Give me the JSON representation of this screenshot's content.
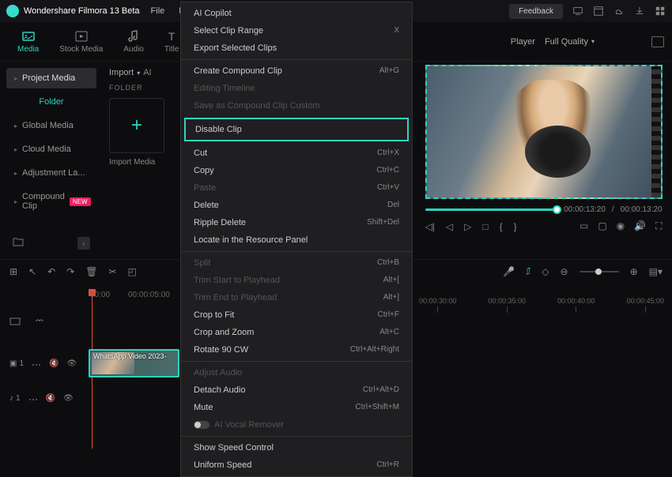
{
  "app": {
    "title": "Wondershare Filmora 13 Beta"
  },
  "menubar": {
    "file": "File",
    "edit": "Edit"
  },
  "feedback": "Feedback",
  "tabs": {
    "media": "Media",
    "stock": "Stock Media",
    "audio": "Audio",
    "title": "Title"
  },
  "player": {
    "label": "Player",
    "quality": "Full Quality"
  },
  "sidebar": {
    "project": "Project Media",
    "folder": "Folder",
    "global": "Global Media",
    "cloud": "Cloud Media",
    "adjust": "Adjustment La...",
    "compound": "Compound Clip",
    "badge": "NEW"
  },
  "import": {
    "btn": "Import",
    "ai": "AI",
    "folder": "FOLDER",
    "label": "Import Media"
  },
  "ctx": {
    "ai_copilot": "AI Copilot",
    "select_range": "Select Clip Range",
    "select_range_sc": "X",
    "export_sel": "Export Selected Clips",
    "create_comp": "Create Compound Clip",
    "create_comp_sc": "Alt+G",
    "edit_tl": "Editing Timeline",
    "save_comp": "Save as Compound Clip Custom",
    "disable": "Disable Clip",
    "cut": "Cut",
    "cut_sc": "Ctrl+X",
    "copy": "Copy",
    "copy_sc": "Ctrl+C",
    "paste": "Paste",
    "paste_sc": "Ctrl+V",
    "delete": "Delete",
    "delete_sc": "Del",
    "ripple_del": "Ripple Delete",
    "ripple_del_sc": "Shift+Del",
    "locate": "Locate in the Resource Panel",
    "split": "Split",
    "split_sc": "Ctrl+B",
    "trim_start": "Trim Start to Playhead",
    "trim_start_sc": "Alt+[",
    "trim_end": "Trim End to Playhead",
    "trim_end_sc": "Alt+]",
    "crop_fit": "Crop to Fit",
    "crop_fit_sc": "Ctrl+F",
    "crop_zoom": "Crop and Zoom",
    "crop_zoom_sc": "Alt+C",
    "rotate": "Rotate 90 CW",
    "rotate_sc": "Ctrl+Alt+Right",
    "adj_audio": "Adjust Audio",
    "detach": "Detach Audio",
    "detach_sc": "Ctrl+Alt+D",
    "mute": "Mute",
    "mute_sc": "Ctrl+Shift+M",
    "vocal": "AI Vocal Remover",
    "speed_ctrl": "Show Speed Control",
    "uniform": "Uniform Speed",
    "uniform_sc": "Ctrl+R"
  },
  "time": {
    "current": "00:00:13:20",
    "total": "00:00:13:20"
  },
  "timeline": {
    "zero": "00:00",
    "t5": "00:00:05:00",
    "ticks": [
      "00:00:30:00",
      "00:00:35:00",
      "00:00:40:00",
      "00:00:45:00"
    ]
  },
  "tracks": {
    "video": "1",
    "audio": "1",
    "clip_name": "WhatsApp Video 2023-"
  }
}
